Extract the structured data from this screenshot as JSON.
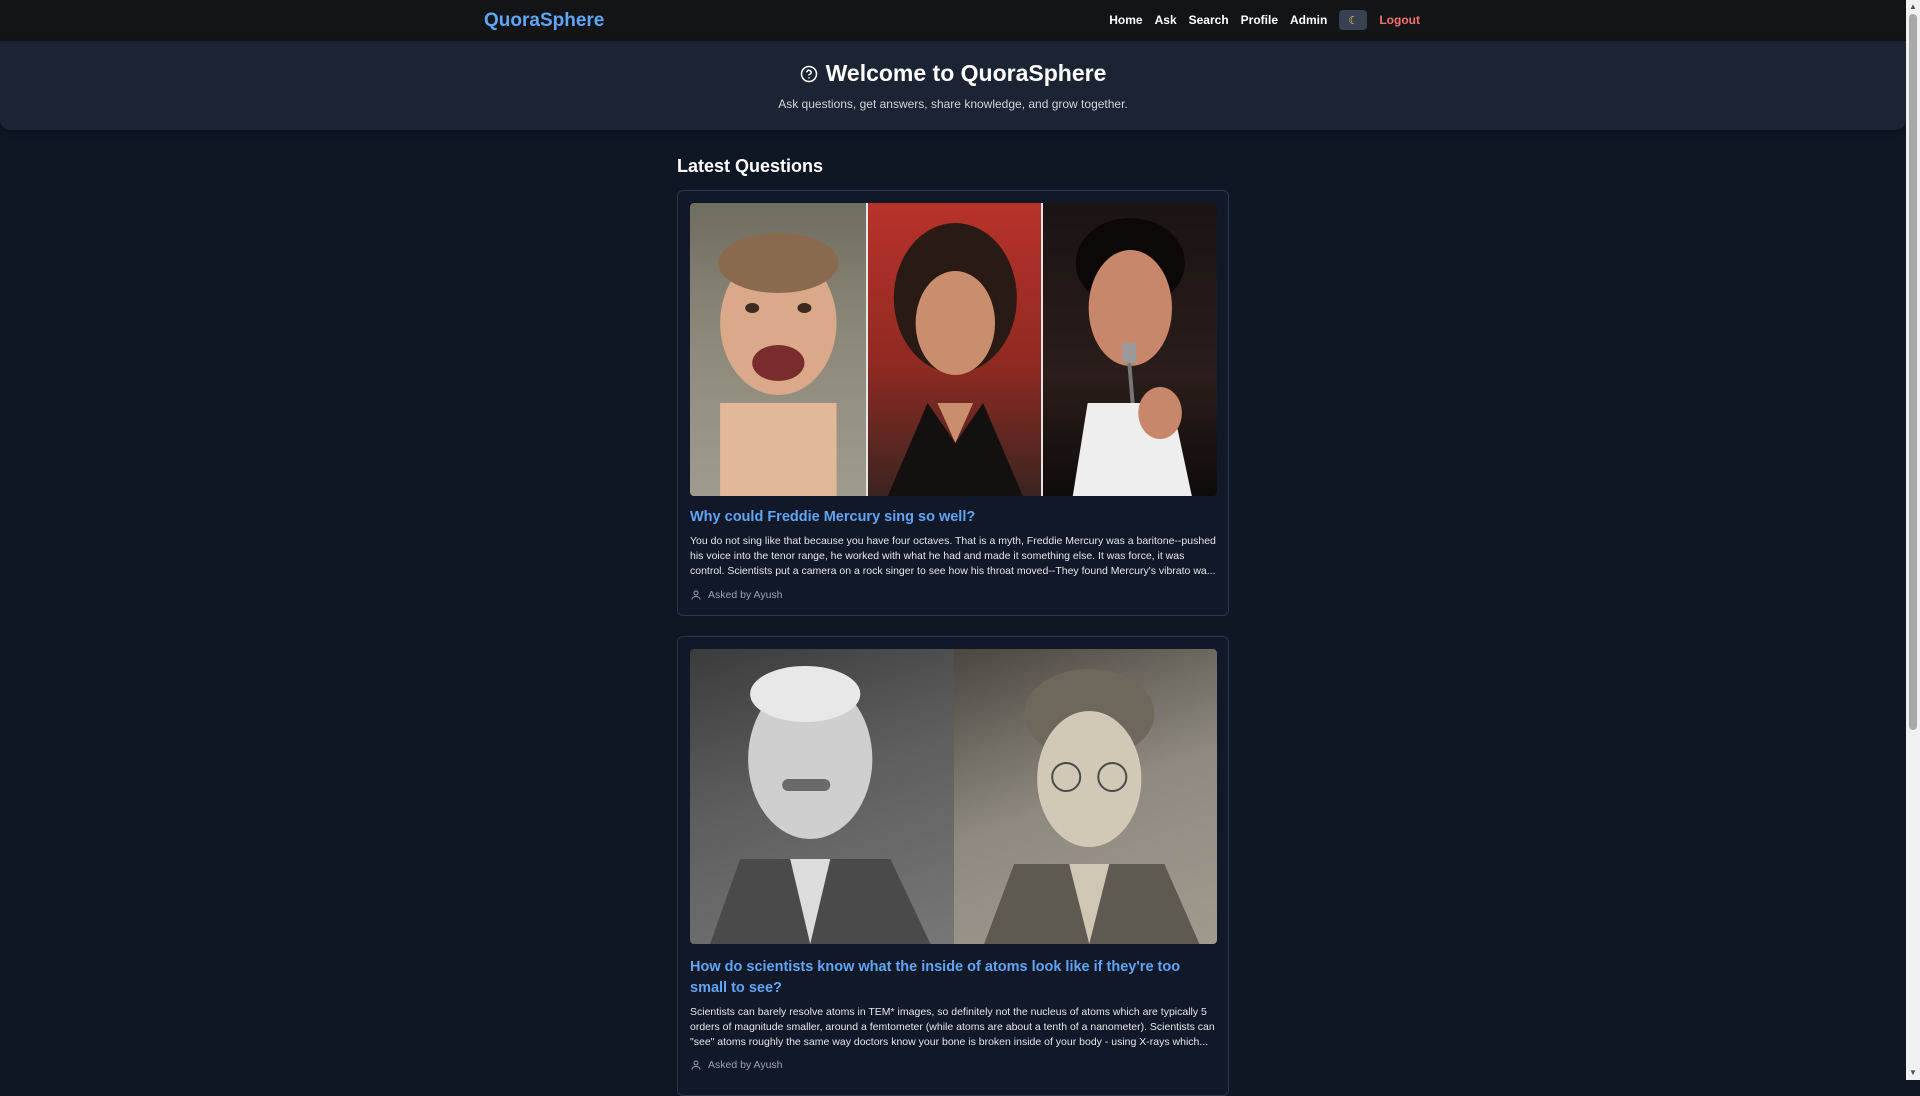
{
  "navbar": {
    "brand": "QuoraSphere",
    "links": [
      "Home",
      "Ask",
      "Search",
      "Profile",
      "Admin"
    ],
    "theme_toggle_icon": "moon-icon",
    "logout": "Logout"
  },
  "hero": {
    "title": "Welcome to QuoraSphere",
    "title_icon": "question-circle-icon",
    "subtitle": "Ask questions, get answers, share knowledge, and grow together."
  },
  "main": {
    "section_title": "Latest Questions",
    "questions": [
      {
        "title": "Why could Freddie Mercury sing so well?",
        "excerpt": "You do not sing like that because you have four octaves. That is a myth, Freddie Mercury was a baritone--pushed his voice into the tenor range, he worked with what he had and made it something else. It was force, it was control. Scientists put a camera on a rock singer to see how his throat moved--They found Mercury's vibrato wa...",
        "asked_by": "Asked by Ayush"
      },
      {
        "title": "How do scientists know what the inside of atoms look like if they're too small to see?",
        "excerpt": "Scientists can barely resolve atoms in TEM* images, so definitely not the nucleus of atoms which are typically 5 orders of magnitude smaller, around a femtometer (while atoms are about a tenth of a nanometer). Scientists can \"see\" atoms roughly the same way doctors know your bone is broken inside of your body - using X-rays which...",
        "asked_by": "Asked by Ayush"
      }
    ]
  },
  "colors": {
    "background": "#0f1725",
    "navbar": "#131416",
    "hero": "#1c2433",
    "accent": "#60a5fa",
    "logout": "#f87171"
  }
}
